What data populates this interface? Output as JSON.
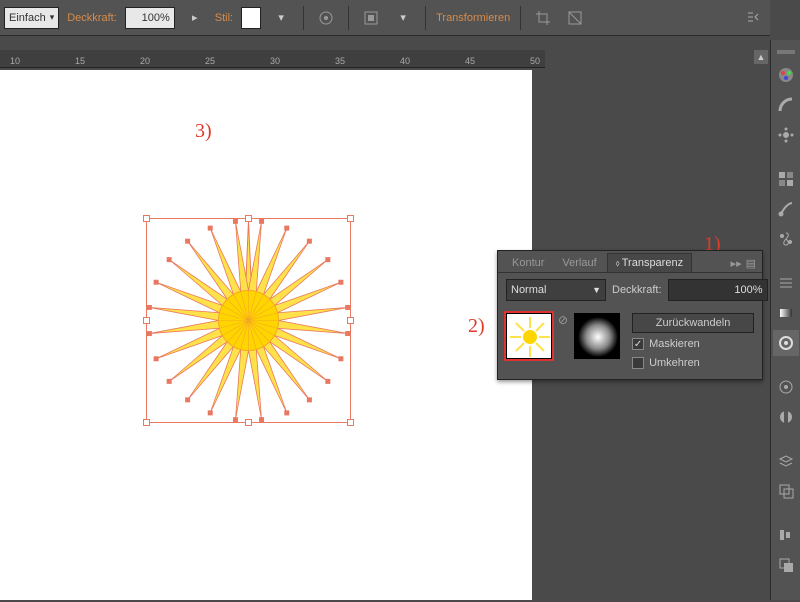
{
  "options": {
    "dropdown1": "Einfach",
    "opacity_label": "Deckkraft:",
    "opacity_value": "100%",
    "style_label": "Stil:",
    "transform_label": "Transformieren"
  },
  "ruler": {
    "labels": [
      "10",
      "15",
      "20",
      "25",
      "30",
      "35",
      "40",
      "45",
      "50"
    ]
  },
  "panel": {
    "tabs": {
      "kontur": "Kontur",
      "verlauf": "Verlauf",
      "transparenz": "Transparenz"
    },
    "blend_mode": "Normal",
    "opacity_label": "Deckkraft:",
    "opacity_value": "100%",
    "revert_btn": "Zurückwandeln",
    "mask_label": "Maskieren",
    "invert_label": "Umkehren"
  },
  "annotations": {
    "one": "1)",
    "two": "2)",
    "three": "3)"
  },
  "icons": {
    "align": "align-icon",
    "transform": "transform-box-icon",
    "crop": "crop-icon",
    "magnet": "magnet-icon",
    "collapse": "collapse-icon"
  },
  "toolstrip": [
    "handle",
    "color-picker",
    "gradient",
    "shapes",
    "swatches",
    "brush",
    "symbol",
    "gap",
    "grid",
    "align2",
    "target",
    "gap",
    "eyedropper",
    "transparency",
    "gap",
    "layers",
    "artboards",
    "links",
    "gap",
    "appearance",
    "graphic-styles"
  ]
}
